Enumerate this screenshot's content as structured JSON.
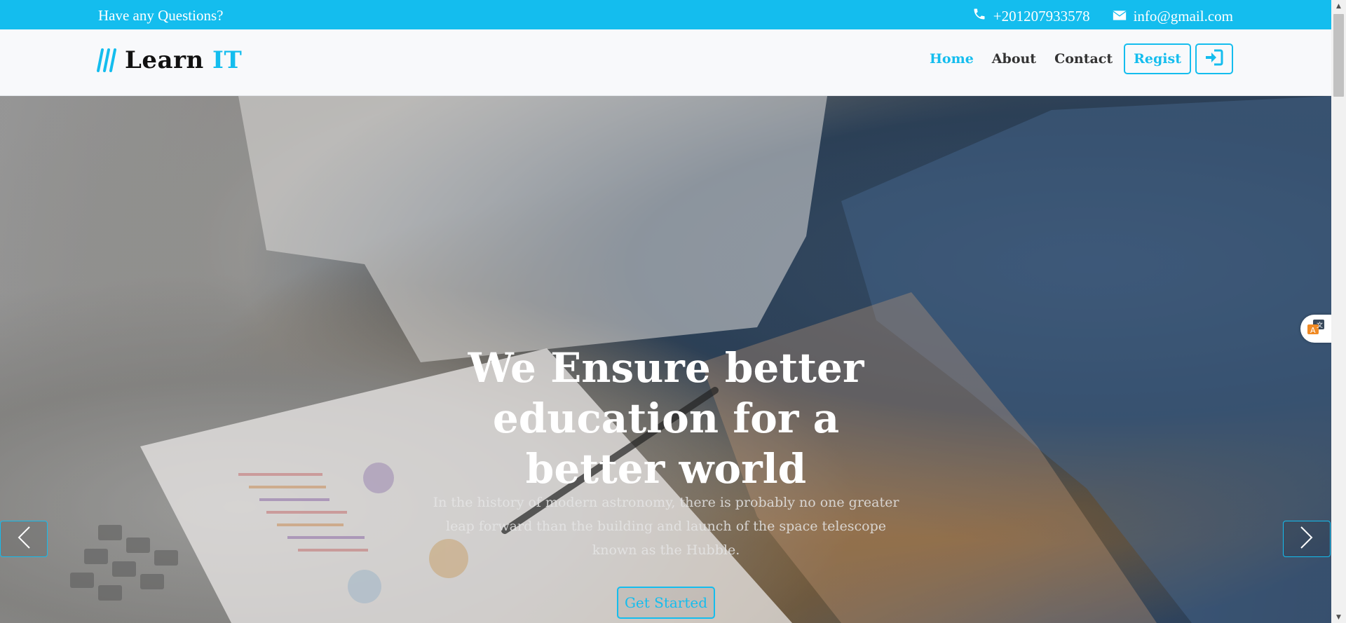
{
  "topbar": {
    "question": "Have any Questions?",
    "phone": "+201207933578",
    "email": "info@gmail.com"
  },
  "navbar": {
    "logo_main": "Learn",
    "logo_accent": "IT",
    "links": [
      {
        "label": "Home",
        "active": true
      },
      {
        "label": "About",
        "active": false
      },
      {
        "label": "Contact",
        "active": false
      }
    ],
    "regist_label": "Regist",
    "login_icon": "sign-in-icon"
  },
  "hero": {
    "title": "We Ensure better education for a better world",
    "subtitle": "In the history of modern astronomy, there is probably no one greater leap forward than the building and launch of the space telescope known as the Hubble.",
    "cta_label": "Get Started"
  },
  "colors": {
    "accent": "#14bdee",
    "nav_text": "#333333",
    "navbar_bg": "#f8f9fb"
  },
  "icons": {
    "phone": "phone-icon",
    "email": "envelope-icon",
    "prev": "chevron-left-icon",
    "next": "chevron-right-icon",
    "widget": "translate-icon"
  }
}
